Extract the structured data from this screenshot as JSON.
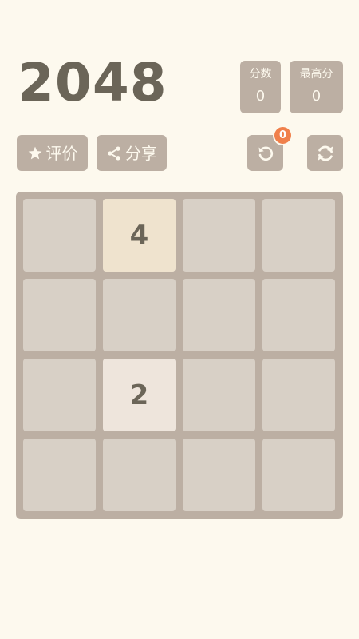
{
  "header": {
    "title": "2048"
  },
  "scores": {
    "current_label": "分数",
    "current_value": "0",
    "best_label": "最高分",
    "best_value": "0"
  },
  "toolbar": {
    "rate_label": "评价",
    "share_label": "分享",
    "undo_count": "0",
    "icons": [
      "star-icon",
      "share-icon",
      "undo-icon",
      "restart-icon"
    ]
  },
  "board": {
    "size": 4,
    "tiles": [
      {
        "row": 0,
        "col": 1,
        "value": "4"
      },
      {
        "row": 2,
        "col": 1,
        "value": "2"
      }
    ]
  },
  "colors": {
    "background": "#fdf9ee",
    "board": "#bcafa3",
    "empty_cell": "#d8d0c6",
    "tile_2": "#eee5dc",
    "tile_4": "#efe3ce",
    "text": "#6b6558",
    "badge": "#f0804b"
  }
}
